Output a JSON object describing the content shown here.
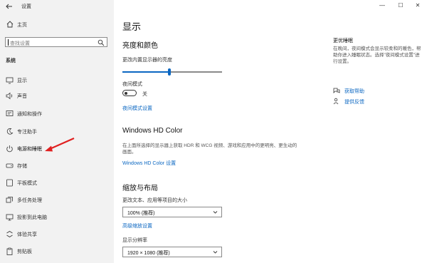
{
  "app": {
    "title": "设置"
  },
  "window_controls": {
    "minimize": "—",
    "maximize": "☐",
    "close": "✕"
  },
  "sidebar": {
    "home_label": "主页",
    "search_placeholder": "查找设置",
    "section_label": "系统",
    "items": [
      {
        "label": "显示",
        "icon": "monitor-icon"
      },
      {
        "label": "声音",
        "icon": "speaker-icon"
      },
      {
        "label": "通知和操作",
        "icon": "notification-icon"
      },
      {
        "label": "专注助手",
        "icon": "moon-icon"
      },
      {
        "label": "电源和睡眠",
        "icon": "power-icon"
      },
      {
        "label": "存储",
        "icon": "storage-icon"
      },
      {
        "label": "平板模式",
        "icon": "tablet-icon"
      },
      {
        "label": "多任务处理",
        "icon": "multitask-icon"
      },
      {
        "label": "投影到此电脑",
        "icon": "project-icon"
      },
      {
        "label": "体验共享",
        "icon": "share-icon"
      },
      {
        "label": "剪贴板",
        "icon": "clipboard-icon"
      }
    ]
  },
  "main": {
    "title": "显示",
    "brightness": {
      "heading": "亮度和颜色",
      "slider_label": "更改内置显示器的亮度",
      "value": 0.47,
      "night_mode_label": "夜间模式",
      "night_mode_state": "关",
      "night_settings_link": "夜间模式设置"
    },
    "hdr": {
      "heading": "Windows HD Color",
      "description": "在上面所选择的显示器上获取 HDR 和 WCG 视频、游戏和应用中的更明亮、更生动的画面。",
      "link": "Windows HD Color 设置"
    },
    "scale": {
      "heading": "缩放与布局",
      "size_label": "更改文本、应用等项目的大小",
      "size_value": "100% (推荐)",
      "advanced_link": "高级缩放设置",
      "resolution_label": "显示分辨率",
      "resolution_value": "1920 × 1080 (推荐)"
    }
  },
  "right": {
    "title": "更优睡眠",
    "description": "在晚间，夜间模式会显示较柔和的暖色，帮助你进入睡眠状态。选择\"夜间模式设置\"进行设置。",
    "help_link": "获取帮助",
    "feedback_link": "提供反馈"
  },
  "colors": {
    "accent": "#0b67c2",
    "annotation_arrow": "#e02020"
  }
}
